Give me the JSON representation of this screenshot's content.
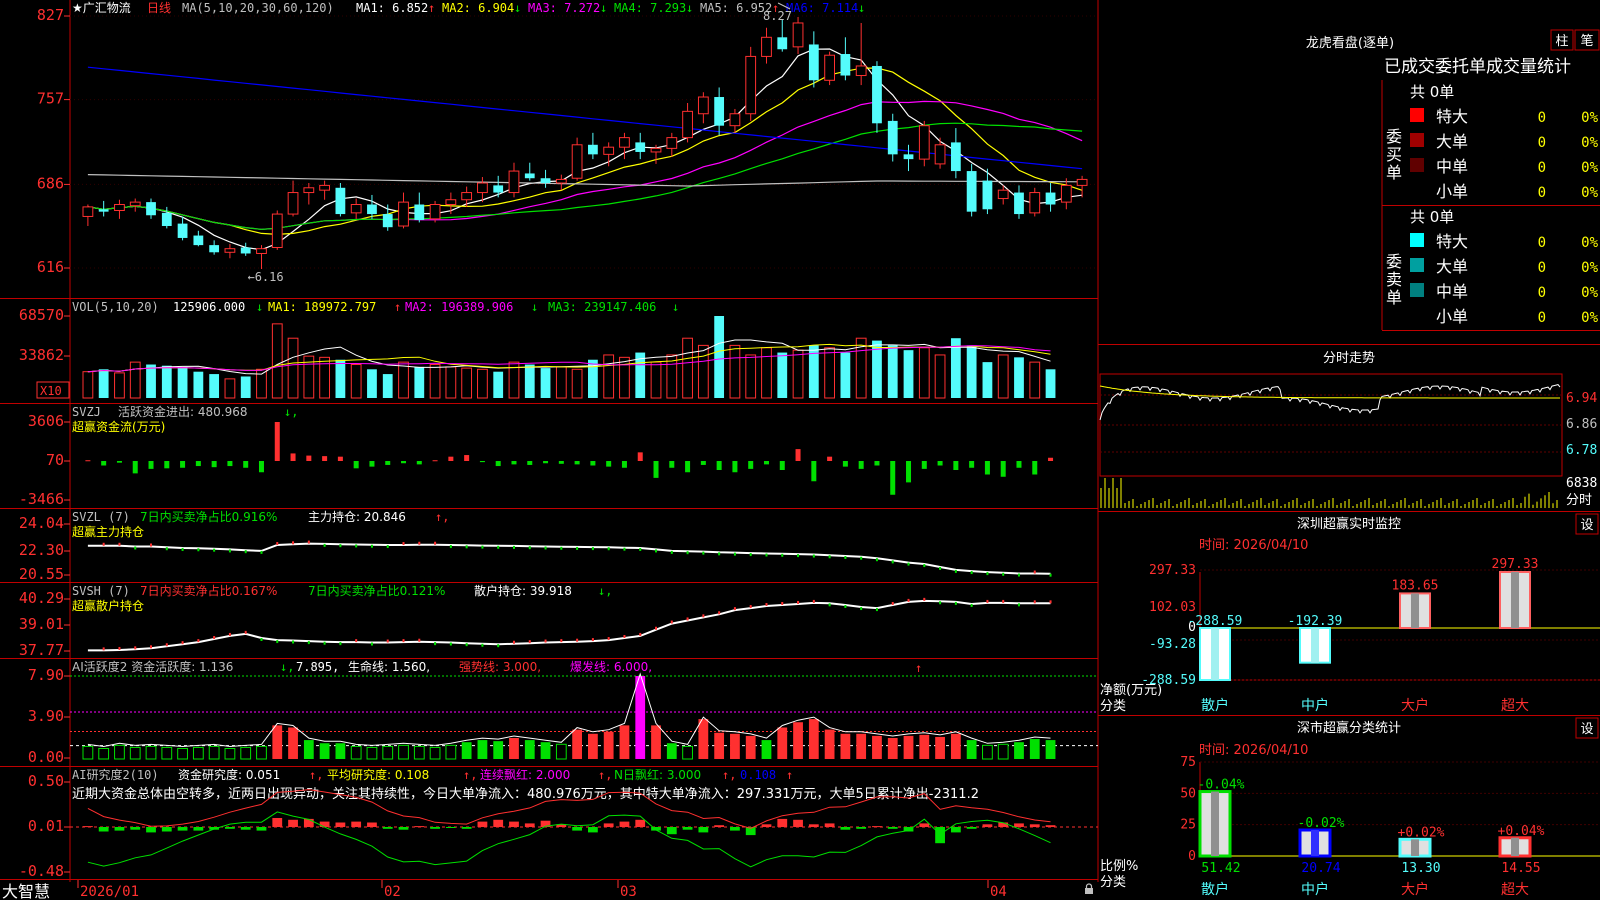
{
  "colors": {
    "up": "#ff3030",
    "down": "#54fcfc",
    "frame": "#c00000",
    "yellow": "#ffff00",
    "magenta": "#ff00ff",
    "white": "#ffffff",
    "green": "#00e000",
    "axisRed": "#ff3030"
  },
  "stock": {
    "title": "★广汇物流",
    "period": "日线",
    "ma_header": "MA(5,10,20,30,60,120)",
    "ma": [
      {
        "label": "MA1:",
        "value": "6.852",
        "arrow": "↑",
        "color": "#ffffff"
      },
      {
        "label": "MA2:",
        "value": "6.904",
        "arrow": "↓",
        "color": "#ffff00"
      },
      {
        "label": "MA3:",
        "value": "7.272",
        "arrow": "↓",
        "color": "#ff00ff"
      },
      {
        "label": "MA4:",
        "value": "7.293",
        "arrow": "↓",
        "color": "#00e000"
      },
      {
        "label": "MA5:",
        "value": "6.952",
        "arrow": "↑",
        "color": "#c0c0c0"
      },
      {
        "label": "MA6:",
        "value": "7.114",
        "arrow": "↓",
        "color": "#0000ff"
      }
    ],
    "high_mark": "8.27",
    "low_mark": "←6.16",
    "price_ticks": [
      "827",
      "757",
      "686",
      "616"
    ]
  },
  "chart_data": [
    {
      "type": "candlestick",
      "title": "广汇物流 日线",
      "x_ticks": [
        "2026/01",
        "02",
        "03",
        "04"
      ],
      "ylim": [
        6.05,
        8.3
      ],
      "candles": [
        {
          "o": 6.6,
          "h": 6.7,
          "l": 6.52,
          "c": 6.68
        },
        {
          "o": 6.66,
          "h": 6.73,
          "l": 6.6,
          "c": 6.64
        },
        {
          "o": 6.65,
          "h": 6.74,
          "l": 6.58,
          "c": 6.7
        },
        {
          "o": 6.69,
          "h": 6.75,
          "l": 6.64,
          "c": 6.72
        },
        {
          "o": 6.72,
          "h": 6.75,
          "l": 6.58,
          "c": 6.61
        },
        {
          "o": 6.63,
          "h": 6.68,
          "l": 6.5,
          "c": 6.52
        },
        {
          "o": 6.54,
          "h": 6.6,
          "l": 6.4,
          "c": 6.42
        },
        {
          "o": 6.44,
          "h": 6.48,
          "l": 6.35,
          "c": 6.36
        },
        {
          "o": 6.36,
          "h": 6.4,
          "l": 6.28,
          "c": 6.3
        },
        {
          "o": 6.3,
          "h": 6.37,
          "l": 6.25,
          "c": 6.33
        },
        {
          "o": 6.34,
          "h": 6.38,
          "l": 6.27,
          "c": 6.29
        },
        {
          "o": 6.29,
          "h": 6.36,
          "l": 6.16,
          "c": 6.33
        },
        {
          "o": 6.34,
          "h": 6.65,
          "l": 6.32,
          "c": 6.62
        },
        {
          "o": 6.62,
          "h": 6.9,
          "l": 6.6,
          "c": 6.8
        },
        {
          "o": 6.8,
          "h": 6.88,
          "l": 6.7,
          "c": 6.84
        },
        {
          "o": 6.82,
          "h": 6.9,
          "l": 6.74,
          "c": 6.86
        },
        {
          "o": 6.84,
          "h": 6.88,
          "l": 6.6,
          "c": 6.62
        },
        {
          "o": 6.63,
          "h": 6.75,
          "l": 6.58,
          "c": 6.7
        },
        {
          "o": 6.7,
          "h": 6.78,
          "l": 6.58,
          "c": 6.62
        },
        {
          "o": 6.62,
          "h": 6.7,
          "l": 6.48,
          "c": 6.51
        },
        {
          "o": 6.52,
          "h": 6.8,
          "l": 6.5,
          "c": 6.72
        },
        {
          "o": 6.7,
          "h": 6.8,
          "l": 6.55,
          "c": 6.57
        },
        {
          "o": 6.58,
          "h": 6.73,
          "l": 6.55,
          "c": 6.7
        },
        {
          "o": 6.7,
          "h": 6.8,
          "l": 6.62,
          "c": 6.74
        },
        {
          "o": 6.74,
          "h": 6.85,
          "l": 6.68,
          "c": 6.8
        },
        {
          "o": 6.8,
          "h": 6.93,
          "l": 6.72,
          "c": 6.88
        },
        {
          "o": 6.86,
          "h": 6.94,
          "l": 6.76,
          "c": 6.8
        },
        {
          "o": 6.8,
          "h": 7.05,
          "l": 6.76,
          "c": 6.98
        },
        {
          "o": 6.96,
          "h": 7.05,
          "l": 6.9,
          "c": 6.92
        },
        {
          "o": 6.92,
          "h": 6.99,
          "l": 6.84,
          "c": 6.88
        },
        {
          "o": 6.88,
          "h": 6.95,
          "l": 6.82,
          "c": 6.91
        },
        {
          "o": 6.92,
          "h": 7.26,
          "l": 6.9,
          "c": 7.2
        },
        {
          "o": 7.2,
          "h": 7.3,
          "l": 7.08,
          "c": 7.12
        },
        {
          "o": 7.12,
          "h": 7.22,
          "l": 7.02,
          "c": 7.18
        },
        {
          "o": 7.18,
          "h": 7.3,
          "l": 7.08,
          "c": 7.26
        },
        {
          "o": 7.22,
          "h": 7.3,
          "l": 7.08,
          "c": 7.14
        },
        {
          "o": 7.14,
          "h": 7.2,
          "l": 7.04,
          "c": 7.17
        },
        {
          "o": 7.17,
          "h": 7.3,
          "l": 7.1,
          "c": 7.26
        },
        {
          "o": 7.26,
          "h": 7.55,
          "l": 7.22,
          "c": 7.48
        },
        {
          "o": 7.46,
          "h": 7.64,
          "l": 7.38,
          "c": 7.6
        },
        {
          "o": 7.6,
          "h": 7.68,
          "l": 7.28,
          "c": 7.36
        },
        {
          "o": 7.36,
          "h": 7.5,
          "l": 7.3,
          "c": 7.46
        },
        {
          "o": 7.46,
          "h": 8.02,
          "l": 7.4,
          "c": 7.94
        },
        {
          "o": 7.94,
          "h": 8.18,
          "l": 7.88,
          "c": 8.1
        },
        {
          "o": 8.1,
          "h": 8.25,
          "l": 7.98,
          "c": 8.0
        },
        {
          "o": 8.02,
          "h": 8.27,
          "l": 7.96,
          "c": 8.22
        },
        {
          "o": 8.04,
          "h": 8.15,
          "l": 7.68,
          "c": 7.74
        },
        {
          "o": 7.74,
          "h": 7.98,
          "l": 7.7,
          "c": 7.95
        },
        {
          "o": 7.96,
          "h": 8.1,
          "l": 7.74,
          "c": 7.78
        },
        {
          "o": 7.78,
          "h": 8.22,
          "l": 7.7,
          "c": 7.86
        },
        {
          "o": 7.86,
          "h": 7.9,
          "l": 7.3,
          "c": 7.38
        },
        {
          "o": 7.4,
          "h": 7.46,
          "l": 7.06,
          "c": 7.12
        },
        {
          "o": 7.12,
          "h": 7.2,
          "l": 6.98,
          "c": 7.08
        },
        {
          "o": 7.08,
          "h": 7.4,
          "l": 7.02,
          "c": 7.36
        },
        {
          "o": 7.04,
          "h": 7.26,
          "l": 7.0,
          "c": 7.2
        },
        {
          "o": 7.22,
          "h": 7.34,
          "l": 6.92,
          "c": 6.98
        },
        {
          "o": 6.98,
          "h": 7.04,
          "l": 6.6,
          "c": 6.64
        },
        {
          "o": 6.9,
          "h": 7.0,
          "l": 6.62,
          "c": 6.66
        },
        {
          "o": 6.75,
          "h": 6.86,
          "l": 6.7,
          "c": 6.82
        },
        {
          "o": 6.8,
          "h": 6.86,
          "l": 6.58,
          "c": 6.62
        },
        {
          "o": 6.63,
          "h": 6.84,
          "l": 6.6,
          "c": 6.8
        },
        {
          "o": 6.8,
          "h": 6.88,
          "l": 6.64,
          "c": 6.7
        },
        {
          "o": 6.72,
          "h": 6.92,
          "l": 6.66,
          "c": 6.86
        },
        {
          "o": 6.86,
          "h": 6.94,
          "l": 6.76,
          "c": 6.91
        }
      ]
    },
    {
      "type": "bar",
      "name": "VOL",
      "values": [
        22000,
        24000,
        21000,
        30000,
        28000,
        27000,
        26000,
        22000,
        20000,
        16000,
        18000,
        24000,
        62000,
        50000,
        35000,
        34000,
        32000,
        28000,
        24000,
        20000,
        30000,
        26000,
        28000,
        26000,
        25000,
        24000,
        22000,
        30000,
        28000,
        25000,
        26000,
        24000,
        32000,
        36000,
        34000,
        38000,
        30000,
        36000,
        50000,
        44000,
        68570,
        44000,
        36000,
        42000,
        38000,
        40000,
        44000,
        42000,
        38000,
        50000,
        48000,
        44000,
        40000,
        42000,
        36000,
        50000,
        44000,
        30000,
        36000,
        34000,
        30000,
        24000
      ]
    },
    {
      "type": "bar",
      "name": "SVZJ",
      "values": [
        70,
        -400,
        -150,
        -1100,
        -700,
        -650,
        -600,
        -450,
        -550,
        -450,
        -600,
        -1000,
        3606,
        700,
        500,
        450,
        400,
        -650,
        -500,
        -350,
        -200,
        -300,
        70,
        400,
        550,
        -100,
        -450,
        -300,
        -350,
        -200,
        -250,
        -300,
        -400,
        -500,
        -600,
        800,
        -1500,
        -600,
        -1000,
        -350,
        -800,
        -1000,
        -700,
        -300,
        -800,
        1100,
        -1800,
        400,
        -500,
        -700,
        -400,
        -3000,
        -1900,
        -700,
        -400,
        -800,
        -600,
        -1200,
        -1400,
        -600,
        -1200,
        300
      ]
    },
    {
      "type": "line",
      "name": "SVZL",
      "values": [
        22.55,
        22.55,
        22.55,
        22.5,
        22.5,
        22.45,
        22.4,
        22.38,
        22.35,
        22.3,
        22.25,
        22.2,
        22.6,
        22.65,
        22.7,
        22.68,
        22.66,
        22.64,
        22.62,
        22.6,
        22.6,
        22.62,
        22.62,
        22.6,
        22.58,
        22.56,
        22.55,
        22.54,
        22.52,
        22.5,
        22.48,
        22.47,
        22.46,
        22.45,
        22.42,
        22.4,
        22.3,
        22.2,
        22.18,
        22.15,
        22.1,
        22.08,
        22.05,
        22.02,
        22.0,
        21.98,
        21.95,
        21.9,
        21.85,
        21.8,
        21.7,
        21.55,
        21.4,
        21.3,
        21.1,
        20.9,
        20.82,
        20.75,
        20.7,
        20.65,
        20.65,
        20.64
      ]
    },
    {
      "type": "line",
      "name": "SVSH",
      "values": [
        37.8,
        37.8,
        37.82,
        37.85,
        37.9,
        38.0,
        38.1,
        38.2,
        38.35,
        38.5,
        38.6,
        38.4,
        38.3,
        38.28,
        38.25,
        38.22,
        38.2,
        38.2,
        38.18,
        38.18,
        38.2,
        38.22,
        38.2,
        38.18,
        38.15,
        38.12,
        38.1,
        38.12,
        38.15,
        38.18,
        38.2,
        38.22,
        38.25,
        38.3,
        38.4,
        38.5,
        38.8,
        39.1,
        39.25,
        39.4,
        39.55,
        39.75,
        39.85,
        39.95,
        40.0,
        40.05,
        40.1,
        40.08,
        40.0,
        39.9,
        39.85,
        40.0,
        40.15,
        40.2,
        40.18,
        40.15,
        40.05,
        40.1,
        40.1,
        40.08,
        40.08,
        40.08
      ]
    },
    {
      "type": "bar",
      "name": "AI活跃度2",
      "values": [
        1.2,
        1.0,
        1.3,
        1.1,
        1.2,
        1.1,
        1.0,
        1.1,
        1.2,
        1.0,
        1.1,
        1.2,
        3.2,
        3.0,
        1.8,
        1.5,
        1.5,
        1.2,
        1.1,
        1.2,
        1.3,
        1.2,
        1.1,
        1.3,
        1.6,
        1.8,
        1.7,
        2.0,
        1.8,
        1.6,
        1.4,
        2.8,
        2.4,
        2.6,
        3.2,
        7.9,
        3.2,
        1.5,
        1.2,
        3.8,
        2.5,
        2.4,
        2.2,
        1.8,
        3.0,
        3.5,
        3.8,
        2.8,
        2.4,
        2.4,
        2.2,
        2.0,
        2.2,
        2.3,
        2.1,
        2.4,
        1.8,
        1.3,
        1.4,
        1.6,
        1.9,
        1.8
      ]
    },
    {
      "type": "bar",
      "name": "AI研究度2",
      "values": [
        0.01,
        -0.05,
        -0.04,
        -0.03,
        -0.06,
        -0.05,
        -0.04,
        -0.04,
        -0.03,
        -0.02,
        -0.03,
        -0.04,
        0.1,
        0.08,
        0.09,
        0.06,
        0.05,
        0.06,
        0.05,
        -0.02,
        -0.03,
        0.01,
        -0.02,
        -0.01,
        -0.02,
        0.06,
        0.08,
        0.06,
        0.04,
        0.07,
        0.03,
        -0.04,
        -0.06,
        0.04,
        0.06,
        0.08,
        -0.04,
        -0.08,
        -0.03,
        -0.06,
        0.02,
        -0.04,
        -0.09,
        0.03,
        0.09,
        0.08,
        0.03,
        0.04,
        -0.03,
        -0.02,
        0.01,
        -0.02,
        -0.05,
        0.04,
        -0.18,
        -0.06,
        -0.02,
        0.03,
        0.05,
        0.04,
        0.03,
        0.02
      ]
    },
    {
      "type": "bar",
      "name": "深圳超赢实时监控",
      "categories": [
        "散户",
        "中户",
        "大户",
        "超大"
      ],
      "values": [
        -288.59,
        -192.39,
        183.65,
        297.33
      ],
      "ylim": [
        -288.59,
        297.33
      ]
    },
    {
      "type": "bar",
      "name": "深市超赢分类统计",
      "categories": [
        "散户",
        "中户",
        "大户",
        "超大"
      ],
      "values": [
        51.42,
        20.74,
        13.3,
        14.55
      ],
      "changes": [
        "-0.04%",
        "-0.02%",
        "+0.02%",
        "+0.04%"
      ],
      "ylim": [
        0,
        75
      ]
    }
  ],
  "vol": {
    "header": "VOL(5,10,20)",
    "value": "125906.000",
    "arrow1": "↓",
    "ma1": "MA1: 189972.797",
    "arrow2": "↑",
    "ma2": "MA2: 196389.906",
    "arrow3": "↓",
    "ma3": "MA3: 239147.406",
    "arrow4": "↓",
    "ticks": [
      "68570",
      "33862"
    ],
    "unit": "X10"
  },
  "svzj": {
    "header": "SVZJ",
    "label": "活跃资金进出: 480.968",
    "arrow": "↓,",
    "sub": "超赢资金流(万元)",
    "ticks": [
      "3606",
      "70",
      "-3466"
    ]
  },
  "svzl": {
    "header": "SVZL (7)",
    "pct": "7日内买卖净占比0.916%",
    "hold": "主力持仓: 20.846",
    "arrow": "↑,",
    "sub": "超赢主力持仓",
    "ticks": [
      "24.04",
      "22.30",
      "20.55"
    ]
  },
  "svsh": {
    "header": "SVSH (7)",
    "pct1": "7日内买卖净占比0.167%",
    "pct2": "7日内买卖净占比0.121%",
    "hold": "散户持仓: 39.918",
    "arrow": "↓,",
    "sub": "超赢散户持仓",
    "ticks": [
      "40.29",
      "39.01",
      "37.77"
    ]
  },
  "ai_active": {
    "header": "AI活跃度2 资金活跃度: 1.136",
    "a1": "↓,",
    "v2": "7.895,",
    "life": "生命线: 1.560,",
    "strong": "强势线: 3.000,",
    "burst": "爆发线: 6.000,",
    "ticks": [
      "7.90",
      "3.90",
      "0.00"
    ]
  },
  "ai_research": {
    "header": "AI研究度2(10)",
    "fund": "资金研究度: 0.051",
    "a1": "↑,",
    "avg": "平均研究度: 0.108",
    "a2": "↑,",
    "lian": "连续飘红: 2.000",
    "a3": "↑,",
    "nday": "N日飘红: 3.000",
    "a4": "↑,",
    "last": "0.108",
    "a5": "↑",
    "comment": "近期大资金总体由空转多，近两日出现异动，关注其持续性，今日大单净流入：480.976万元，其中特大单净流入：297.331万元，大单5日累计净出-2311.2",
    "ticks": [
      "0.50",
      "0.01",
      "-0.48"
    ]
  },
  "footer": {
    "logo": "大智慧"
  },
  "right": {
    "lhb_title": "龙虎看盘(逐单)",
    "btn_zhu": "柱",
    "btn_bi": "笔",
    "stat_title": "已成交委托单成交量统计",
    "buy_label": "委买单",
    "sell_label": "委卖单",
    "buy_total": "共 0单",
    "sell_total": "共 0单",
    "buy_rows": [
      {
        "name": "特大",
        "color": "#ff0000",
        "val": "0",
        "pct": "0%"
      },
      {
        "name": "大单",
        "color": "#a00000",
        "val": "0",
        "pct": "0%"
      },
      {
        "name": "中单",
        "color": "#600000",
        "val": "0",
        "pct": "0%"
      },
      {
        "name": "小单",
        "color": "",
        "val": "0",
        "pct": "0%"
      }
    ],
    "sell_rows": [
      {
        "name": "特大",
        "color": "#00ffff",
        "val": "0",
        "pct": "0%"
      },
      {
        "name": "大单",
        "color": "#00a0a0",
        "val": "0",
        "pct": "0%"
      },
      {
        "name": "中单",
        "color": "#008080",
        "val": "0",
        "pct": "0%"
      },
      {
        "name": "小单",
        "color": "",
        "val": "0",
        "pct": "0%"
      }
    ],
    "intraday_title": "分时走势",
    "intraday_ticks": [
      "6.94",
      "6.86",
      "6.78"
    ],
    "intraday_vol": "6838",
    "intraday_vol_unit": "分时",
    "sz_title": "深圳超赢实时监控",
    "settings": "设",
    "sz_time": "时间: 2026/04/10",
    "sz_ticks": [
      "297.33",
      "102.03",
      "0",
      "-93.28",
      "-288.59"
    ],
    "sz_net": "净额(万元)",
    "sz_cat": "分类",
    "cls_title": "深市超赢分类统计",
    "cls_time": "时间: 2026/04/10",
    "cls_ticks": [
      "75",
      "50",
      "25",
      "0"
    ],
    "cls_ratio": "比例%",
    "cls_cat": "分类"
  }
}
